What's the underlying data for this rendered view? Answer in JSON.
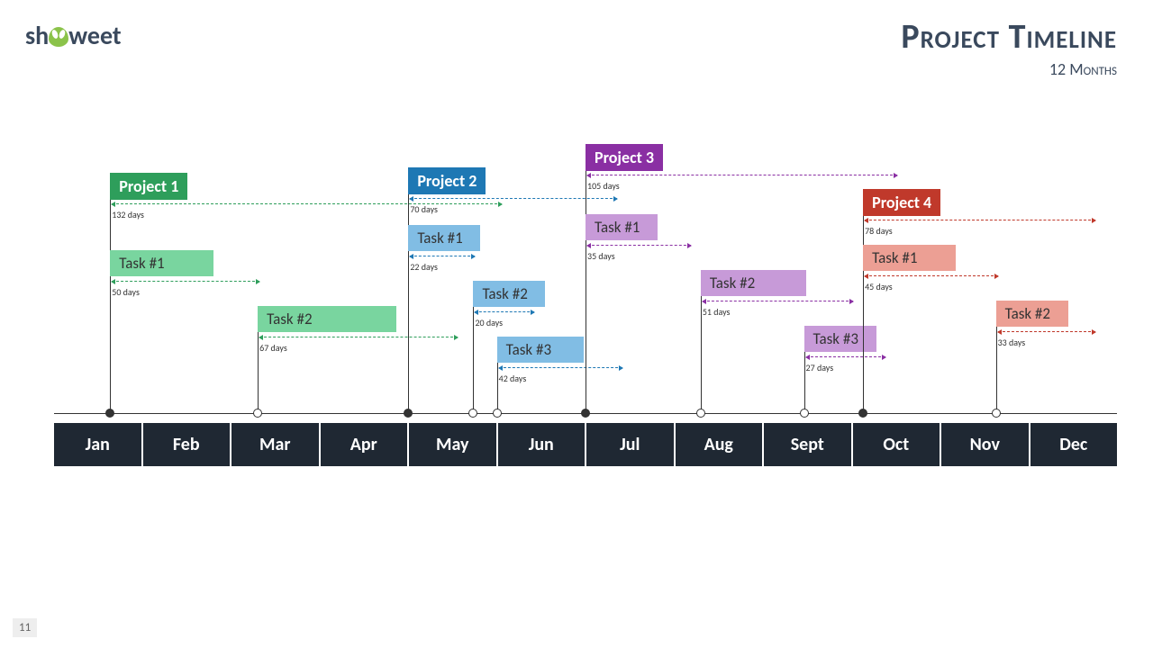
{
  "logo_pre": "sh",
  "logo_post": "weet",
  "title": "Project Timeline",
  "subtitle": "12 Months",
  "page_number": "11",
  "months": [
    "Jan",
    "Feb",
    "Mar",
    "Apr",
    "May",
    "Jun",
    "Jul",
    "Aug",
    "Sept",
    "Oct",
    "Nov",
    "Dec"
  ],
  "chart_data": {
    "type": "bar",
    "title": "Project Timeline",
    "subtitle": "12 Months",
    "xlabel": "",
    "ylabel": "",
    "categories": [
      "Jan",
      "Feb",
      "Mar",
      "Apr",
      "May",
      "Jun",
      "Jul",
      "Aug",
      "Sept",
      "Oct",
      "Nov",
      "Dec"
    ],
    "series": [
      {
        "name": "Project 1",
        "color": "#2e9e5b",
        "start_month": "Jan",
        "start_day": 20,
        "duration_days": 132,
        "duration_label": "132 days",
        "tasks": [
          {
            "name": "Task #1",
            "start_month": "Jan",
            "start_day": 20,
            "duration_days": 50,
            "label": "50 days",
            "color": "#79d59f"
          },
          {
            "name": "Task #2",
            "start_month": "Mar",
            "start_day": 10,
            "duration_days": 67,
            "label": "67 days",
            "color": "#79d59f"
          }
        ]
      },
      {
        "name": "Project 2",
        "color": "#1e78b4",
        "start_month": "May",
        "start_day": 1,
        "duration_days": 70,
        "duration_label": "70 days",
        "tasks": [
          {
            "name": "Task #1",
            "start_month": "May",
            "start_day": 1,
            "duration_days": 22,
            "label": "22 days",
            "color": "#81bde4"
          },
          {
            "name": "Task #2",
            "start_month": "May",
            "start_day": 23,
            "duration_days": 20,
            "label": "20 days",
            "color": "#81bde4"
          },
          {
            "name": "Task #3",
            "start_month": "Jun",
            "start_day": 1,
            "duration_days": 42,
            "label": "42 days",
            "color": "#81bde4"
          }
        ]
      },
      {
        "name": "Project 3",
        "color": "#8a2fa3",
        "start_month": "Jul",
        "start_day": 1,
        "duration_days": 105,
        "duration_label": "105 days",
        "tasks": [
          {
            "name": "Task #1",
            "start_month": "Jul",
            "start_day": 1,
            "duration_days": 35,
            "label": "35 days",
            "color": "#c79ad8"
          },
          {
            "name": "Task #2",
            "start_month": "Aug",
            "start_day": 10,
            "duration_days": 51,
            "label": "51 days",
            "color": "#c79ad8"
          },
          {
            "name": "Task #3",
            "start_month": "Sept",
            "start_day": 15,
            "duration_days": 27,
            "label": "27 days",
            "color": "#c79ad8"
          }
        ]
      },
      {
        "name": "Project 4",
        "color": "#c0392b",
        "start_month": "Oct",
        "start_day": 5,
        "duration_days": 78,
        "duration_label": "78 days",
        "tasks": [
          {
            "name": "Task #1",
            "start_month": "Oct",
            "start_day": 5,
            "duration_days": 45,
            "label": "45 days",
            "color": "#ec9f94"
          },
          {
            "name": "Task #2",
            "start_month": "Nov",
            "start_day": 20,
            "duration_days": 33,
            "label": "33 days",
            "color": "#ec9f94"
          }
        ]
      }
    ]
  }
}
